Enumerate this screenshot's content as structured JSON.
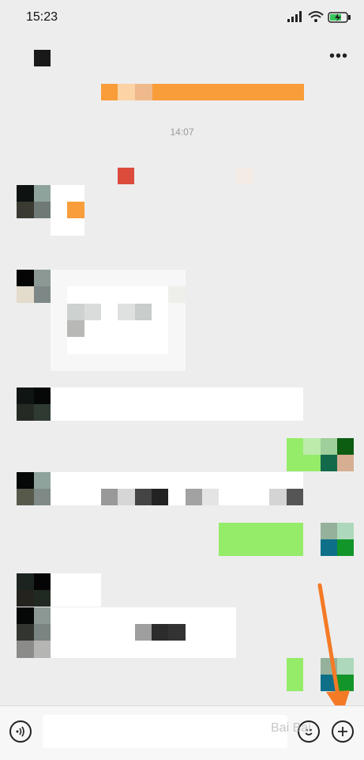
{
  "status_bar": {
    "time": "15:23"
  },
  "header": {
    "more_label": "•••"
  },
  "chat": {
    "timestamp": "14:07"
  },
  "watermark_text": "Bai Bai"
}
